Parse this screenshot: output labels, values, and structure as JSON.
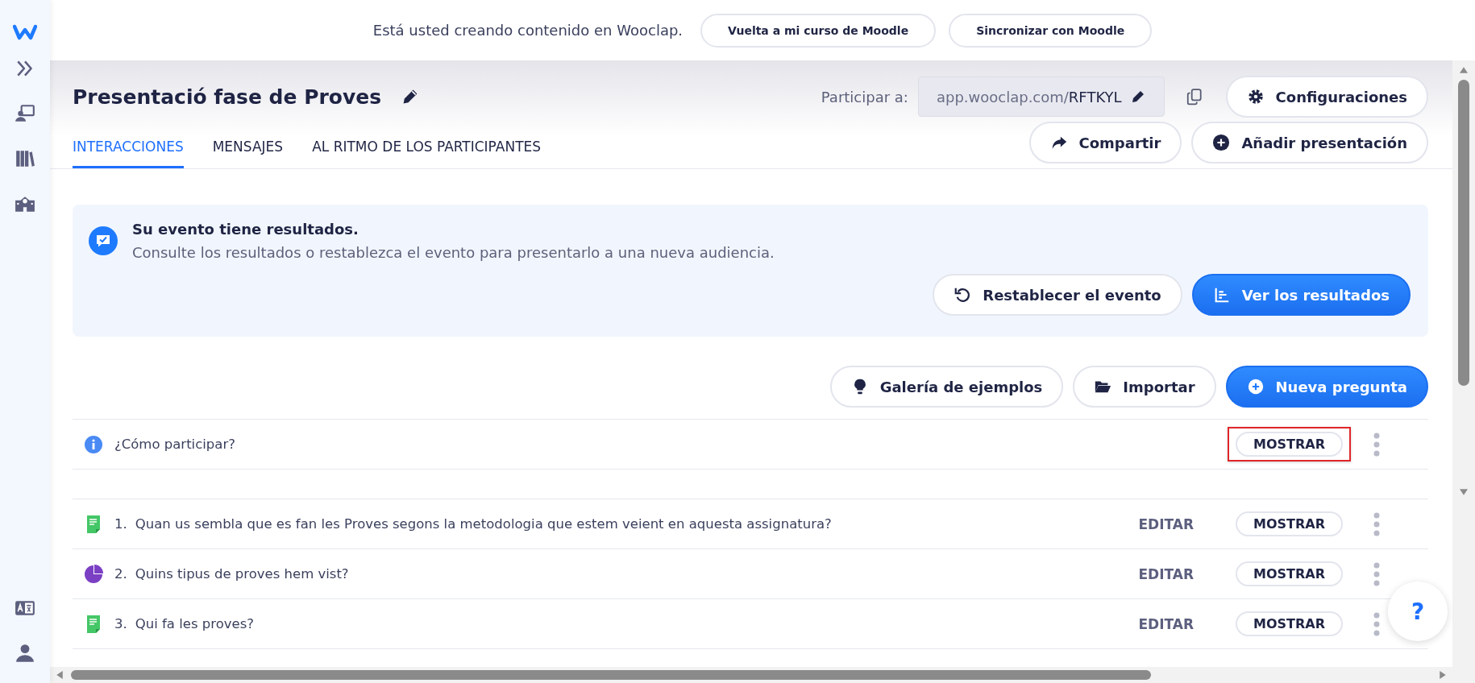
{
  "sidebar": {
    "items": [
      {
        "kind": "expand"
      },
      {
        "kind": "presenter"
      },
      {
        "kind": "library"
      },
      {
        "kind": "school"
      }
    ],
    "bottom_items": [
      {
        "kind": "language"
      },
      {
        "kind": "user"
      }
    ]
  },
  "top_bar": {
    "message": "Está usted creando contenido en Wooclap.",
    "buttons": [
      "Vuelta a mi curso de Moodle",
      "Sincronizar con Moodle"
    ]
  },
  "header": {
    "title": "Presentació fase de Proves",
    "participate_label": "Participar a:",
    "link_prefix": "app.wooclap.com/",
    "link_code": "RFTKYL",
    "settings_button": "Configuraciones",
    "share_button": "Compartir",
    "add_button": "Añadir presentación"
  },
  "tabs": [
    {
      "label": "INTERACCIONES",
      "selected": true
    },
    {
      "label": "MENSAJES",
      "selected": false
    },
    {
      "label": "AL RITMO DE LOS PARTICIPANTES",
      "selected": false
    }
  ],
  "notice": {
    "title": "Su evento tiene resultados.",
    "text": "Consulte los resultados o restablezca el evento para presentarlo a una nueva audiencia.",
    "reset_button": "Restablecer el evento",
    "results_button": "Ver los resultados"
  },
  "toolbar": {
    "gallery_button": "Galería de ejemplos",
    "import_button": "Importar",
    "new_button": "Nueva pregunta"
  },
  "intro_row": {
    "kind": "info",
    "label": "¿Cómo participar?",
    "show_button": "MOSTRAR",
    "highlighted": true
  },
  "questions": [
    {
      "kind": "text",
      "number": "1.",
      "label": "Quan us sembla que es fan les Proves segons la metodologia que estem veient en aquesta assignatura?",
      "edit_button": "EDITAR",
      "show_button": "MOSTRAR"
    },
    {
      "kind": "poll",
      "number": "2.",
      "label": "Quins tipus de proves hem vist?",
      "edit_button": "EDITAR",
      "show_button": "MOSTRAR"
    },
    {
      "kind": "text",
      "number": "3.",
      "label": "Qui fa les proves?",
      "edit_button": "EDITAR",
      "show_button": "MOSTRAR"
    }
  ],
  "help_button": "?"
}
